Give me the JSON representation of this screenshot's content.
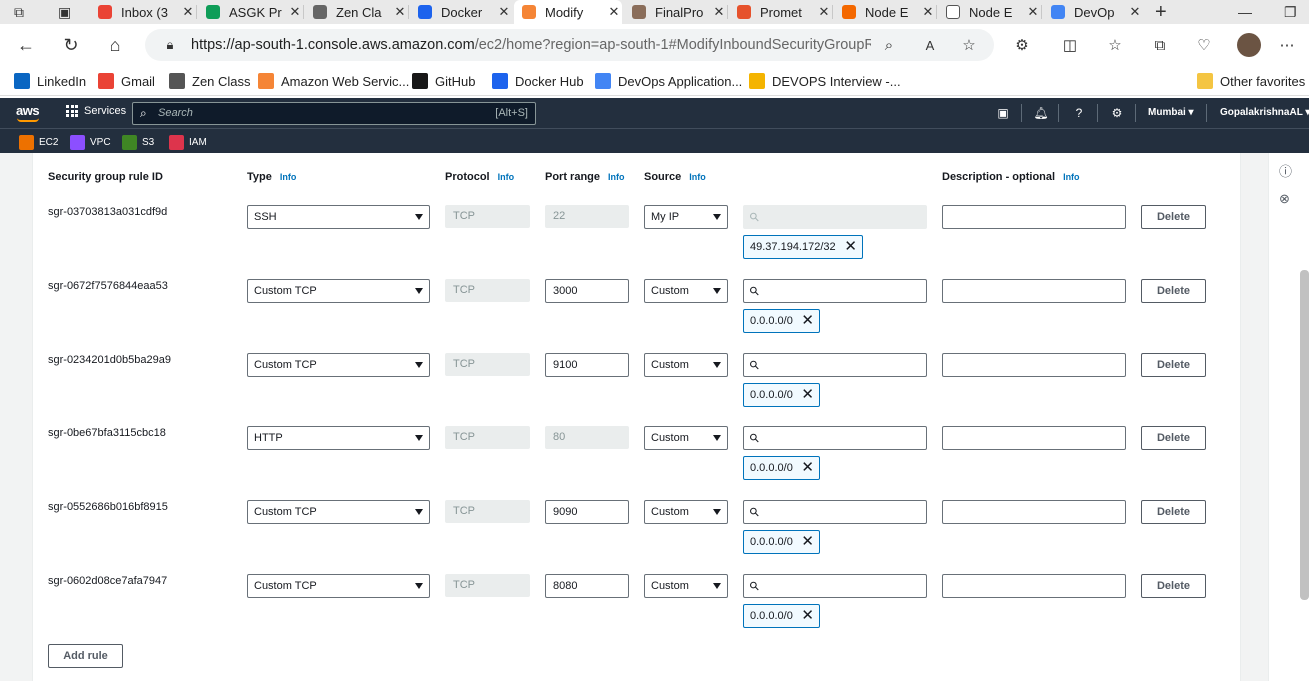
{
  "browser": {
    "tabs": [
      {
        "label": "Inbox (3",
        "icon": "gmail-icon"
      },
      {
        "label": "ASGK Pr",
        "icon": "sheets-icon"
      },
      {
        "label": "Zen Cla",
        "icon": "zen-icon"
      },
      {
        "label": "Docker",
        "icon": "docker-icon"
      },
      {
        "label": "Modify",
        "icon": "aws-icon"
      },
      {
        "label": "FinalPro",
        "icon": "avatar-icon"
      },
      {
        "label": "Promet",
        "icon": "prometheus-icon"
      },
      {
        "label": "Node E",
        "icon": "grafana-icon"
      },
      {
        "label": "Node E",
        "icon": "page-icon"
      },
      {
        "label": "DevOp",
        "icon": "docs-icon"
      }
    ],
    "url_main": "https://ap-south-1.console.aws.amazon.com",
    "url_rest": "/ec2/home?region=ap-south-1#ModifyInboundSecurityGroupR...",
    "bookmarks": [
      {
        "label": "LinkedIn",
        "color": "#0a66c2"
      },
      {
        "label": "Gmail",
        "color": "#ea4335"
      },
      {
        "label": "Zen Class",
        "color": "#555555"
      },
      {
        "label": "Amazon Web Servic...",
        "color": "#f58536"
      },
      {
        "label": "GitHub",
        "color": "#181717"
      },
      {
        "label": "Docker Hub",
        "color": "#1d63ed"
      },
      {
        "label": "DevOps Application...",
        "color": "#4285f4"
      },
      {
        "label": "DEVOPS Interview -...",
        "color": "#f4b400"
      }
    ],
    "other_favorites": "Other favorites"
  },
  "aws": {
    "logo": "aws",
    "services": "Services",
    "search_placeholder": "Search",
    "search_shortcut": "[Alt+S]",
    "region": "Mumbai ▾",
    "user": "GopalakrishnaAL ▾",
    "service_shortcuts": [
      {
        "label": "EC2",
        "color": "#ed7100"
      },
      {
        "label": "VPC",
        "color": "#8c4fff"
      },
      {
        "label": "S3",
        "color": "#3f8624"
      },
      {
        "label": "IAM",
        "color": "#dd344c"
      }
    ]
  },
  "table": {
    "headers": {
      "rule_id": "Security group rule ID",
      "type": "Type",
      "protocol": "Protocol",
      "port_range": "Port range",
      "source": "Source",
      "description": "Description - optional",
      "info": "Info"
    },
    "rows": [
      {
        "id": "sgr-03703813a031cdf9d",
        "type": "SSH",
        "protocol": "TCP",
        "port": "22",
        "port_disabled": true,
        "source": "My IP",
        "search_disabled": true,
        "cidr": "49.37.194.172/32",
        "delete": "Delete"
      },
      {
        "id": "sgr-0672f7576844eaa53",
        "type": "Custom TCP",
        "protocol": "TCP",
        "port": "3000",
        "port_disabled": false,
        "source": "Custom",
        "search_disabled": false,
        "cidr": "0.0.0.0/0",
        "delete": "Delete"
      },
      {
        "id": "sgr-0234201d0b5ba29a9",
        "type": "Custom TCP",
        "protocol": "TCP",
        "port": "9100",
        "port_disabled": false,
        "source": "Custom",
        "search_disabled": false,
        "cidr": "0.0.0.0/0",
        "delete": "Delete"
      },
      {
        "id": "sgr-0be67bfa3115cbc18",
        "type": "HTTP",
        "protocol": "TCP",
        "port": "80",
        "port_disabled": true,
        "source": "Custom",
        "search_disabled": false,
        "cidr": "0.0.0.0/0",
        "delete": "Delete"
      },
      {
        "id": "sgr-0552686b016bf8915",
        "type": "Custom TCP",
        "protocol": "TCP",
        "port": "9090",
        "port_disabled": false,
        "source": "Custom",
        "search_disabled": false,
        "cidr": "0.0.0.0/0",
        "delete": "Delete"
      },
      {
        "id": "sgr-0602d08ce7afa7947",
        "type": "Custom TCP",
        "protocol": "TCP",
        "port": "8080",
        "port_disabled": false,
        "source": "Custom",
        "search_disabled": false,
        "cidr": "0.0.0.0/0",
        "delete": "Delete"
      }
    ],
    "add_rule": "Add rule"
  }
}
